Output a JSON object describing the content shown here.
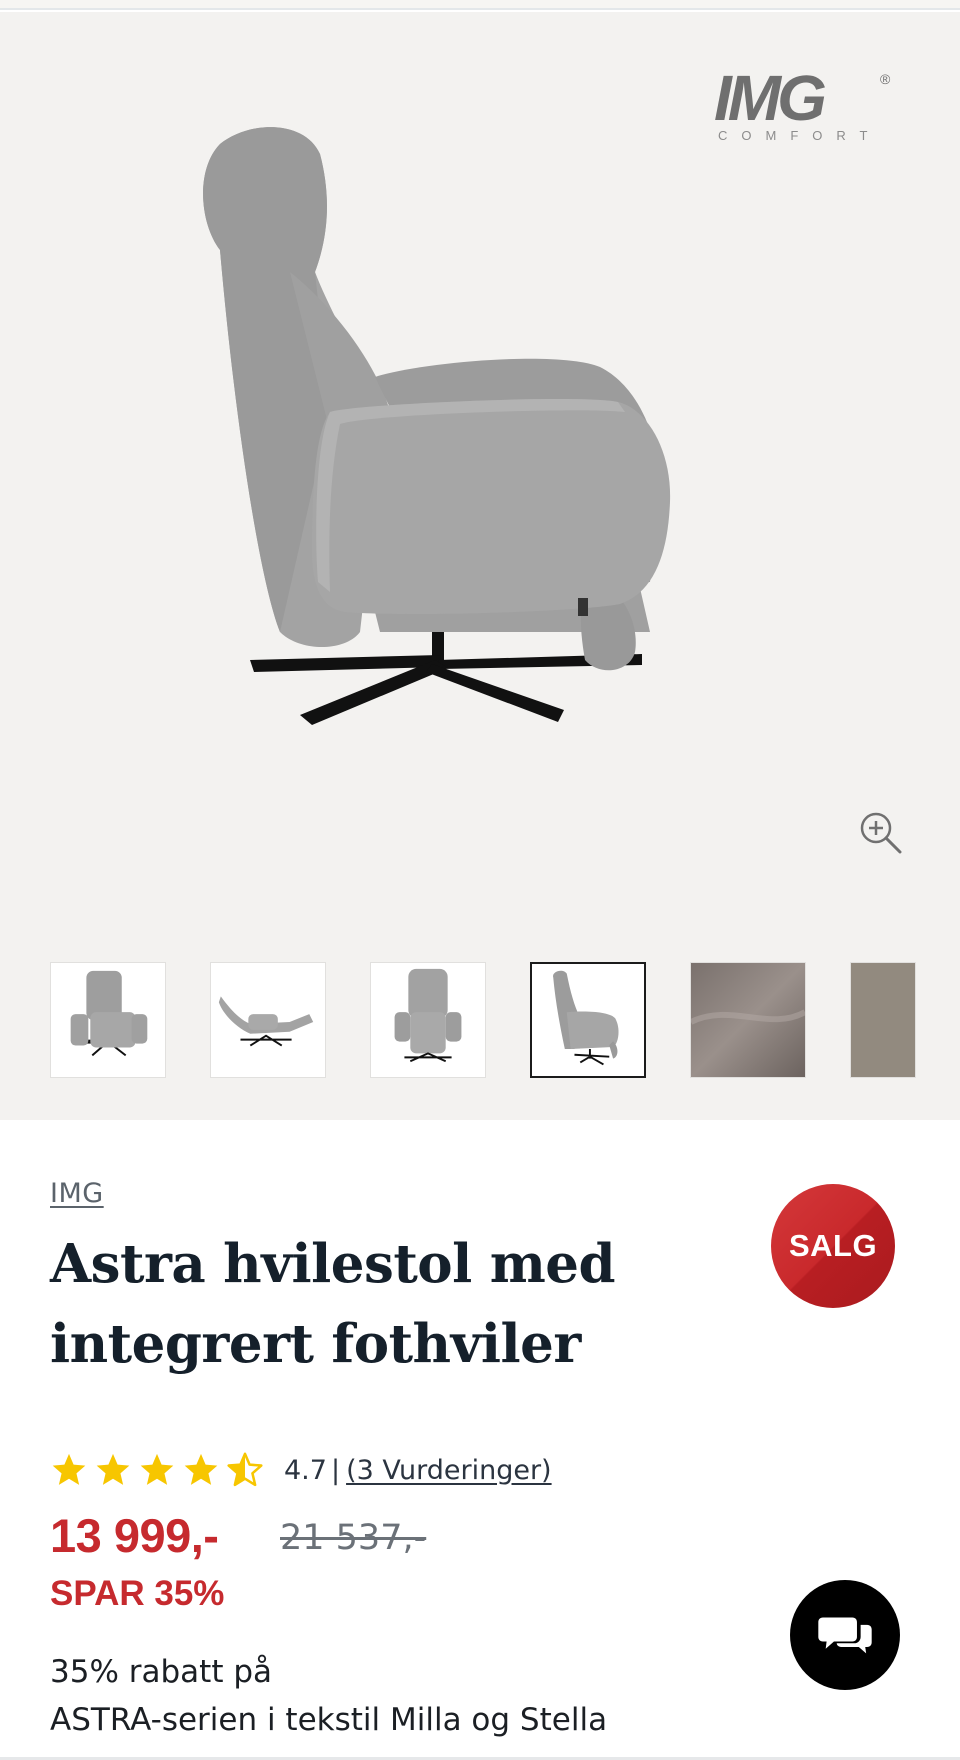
{
  "gallery": {
    "logo": {
      "brand": "IMG",
      "sub": "COMFORT",
      "registered": "®"
    },
    "zoom_icon": "zoom-in-icon",
    "thumbnails": [
      {
        "name": "thumb-front-angle"
      },
      {
        "name": "thumb-reclined"
      },
      {
        "name": "thumb-front"
      },
      {
        "name": "thumb-side",
        "active": true
      },
      {
        "name": "thumb-fabric-closeup"
      },
      {
        "name": "thumb-fabric-swatch"
      }
    ]
  },
  "product": {
    "brand": "IMG",
    "title_line1": "Astra hvilestol med",
    "title_line2": "integrert fothviler",
    "badge": "SALG",
    "rating": {
      "value": "4.7",
      "score": 4.7,
      "max": 5,
      "separator": "|",
      "reviews_label": "(3 Vurderinger)"
    },
    "price": "13 999,-",
    "old_price": "21 537,-",
    "saving": "SPAR 35%",
    "promo_line1": "35% rabatt på",
    "promo_line2": "ASTRA-serien i tekstil Milla og Stella"
  },
  "chat": {
    "icon": "chat-bubbles-icon"
  },
  "colors": {
    "sale_red": "#c62a2e",
    "badge_red": "#c9292c",
    "star_yellow": "#f7c600",
    "text_dark": "#15202b",
    "gallery_bg": "#f3f2f0"
  }
}
